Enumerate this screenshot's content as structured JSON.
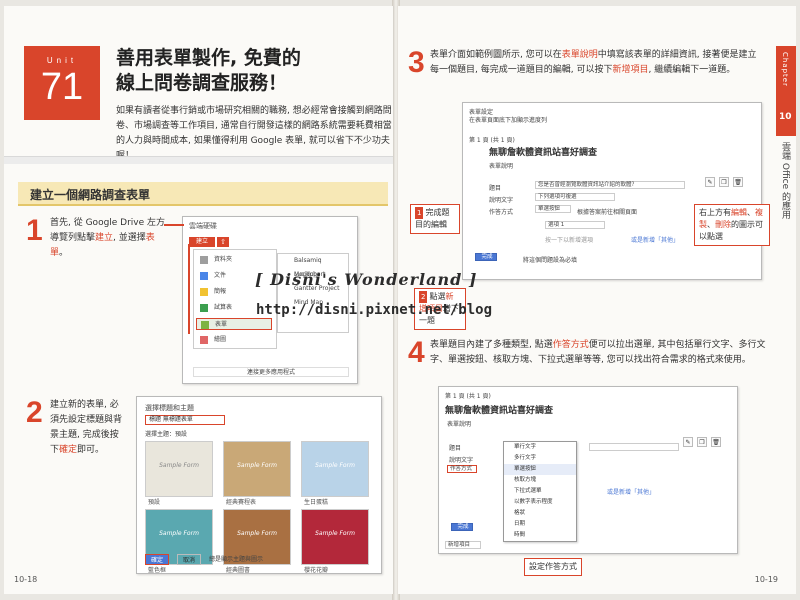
{
  "left_page": {
    "unit_word": "Unit",
    "unit_number": "71",
    "title_line1": "善用表單製作, 免費的",
    "title_line2": "線上問卷調查服務！",
    "intro": "如果有讀者從事行銷或市場研究相關的職務, 想必經常會接觸到網路問卷、市場調查等工作項目, 通常自行開發這樣的網路系統需要耗費相當的人力與時間成本, 如果懂得利用 Google 表單, 就可以省下不少功夫喔！",
    "section_title": "建立一個網路調查表單",
    "step1": {
      "number": "1",
      "text_a": "首先, 從 Google Drive 左方導覽列點擊",
      "text_b": "建立",
      "text_c": ", 並選擇",
      "text_d": "表單",
      "text_e": "。",
      "shot": {
        "header": "雲端硬碟",
        "create_btn": "建立",
        "upload_btn": "⇧",
        "menu_items": [
          "資料夾",
          "文件",
          "簡報",
          "試算表",
          "表單",
          "繪圖"
        ],
        "sub_items": [
          "Balsamiq Mockups",
          "Lucidchart",
          "Gantter Project",
          "Mind Map"
        ],
        "footer": "連接更多應用程式"
      }
    },
    "step2": {
      "number": "2",
      "text_a": "建立新的表單, 必須先設定標題與背景主題, 完成後按下",
      "text_b": "確定",
      "text_c": "即可。",
      "shot": {
        "dialog_title": "選擇標題和主題",
        "title_value": "標題  無標題表單",
        "theme_label": "選擇主題：預設",
        "themes": [
          "預設",
          "經典賽程表",
          "生日蛋糕",
          "藍色框",
          "經典圖書",
          "櫻花花瓣"
        ],
        "theme_sample": "Sample Form",
        "ok": "確定",
        "cancel": "取消",
        "check": "總是顯示主題與圖示"
      }
    },
    "page_number": "10-18"
  },
  "right_page": {
    "step3": {
      "number": "3",
      "text_a": "表單介面如範例圖所示, 您可以在",
      "text_b": "表單說明",
      "text_c": "中填寫該表單的詳細資訊, 接著便是建立每一個題目, 每完成一道題目的編輯, 可以按下",
      "text_d": "新增項目",
      "text_e": ", 繼續編輯下一道題。",
      "shot": {
        "settings_label": "表單設定",
        "settings_check": "在表單頁面底下加顯示進度列",
        "page_label": "第 1 頁 (共 1 頁)",
        "form_title": "無聊詹軟體資訊站喜好調查",
        "form_desc": "表單說明",
        "q_title_label": "題目",
        "q_title_value": "您是否曾經瀏覽軟體資訊站介紹的軟體？",
        "q_help_label": "說明文字",
        "q_help_value": "下列選項可複選",
        "q_type_label": "作答方式",
        "q_type_value": "單選按鈕",
        "q_type_extra": "根據答案前往相關頁面",
        "option1": "選項 1",
        "option_add": "按一下以新增選項",
        "option_other": "或是新增「其他」",
        "done": "完成",
        "required": "將這個問題設為必填",
        "tools": [
          "✎",
          "❐",
          "🗑"
        ]
      },
      "callout_left_badge": "1",
      "callout_left": "完成題目的編輯",
      "callout_right_a": "右上方有",
      "callout_right_b": "編輯",
      "callout_right_c": "、",
      "callout_right_d": "複製",
      "callout_right_e": "、",
      "callout_right_f": "刪除",
      "callout_right_g": "的圖示可以點選",
      "callout_bottom_badge": "2",
      "callout_bottom_a": "點選",
      "callout_bottom_b": "新增項目",
      "callout_bottom_c": "增下一題"
    },
    "watermark_line1": "[ Disni's Wonderland ]",
    "watermark_line2": "http://disni.pixnet.net/blog",
    "step4": {
      "number": "4",
      "text_a": "表單題目內建了多種類型, 點選",
      "text_b": "作答方式",
      "text_c": "便可以拉出選單, 其中包括單行文字、多行文字、單選按鈕、核取方塊、下拉式選單等等, 您可以找出符合需求的格式來使用。",
      "shot": {
        "page_label": "第 1 頁 (共 1 頁)",
        "form_title": "無聊詹軟體資訊站喜好調查",
        "form_desc": "表單說明",
        "q_title_label": "題目",
        "q_help_label": "說明文字",
        "q_type_label": "作答方式",
        "dropdown": [
          "單行文字",
          "多行文字",
          "單選按鈕",
          "核取方塊",
          "下拉式選單",
          "以數字表示程度",
          "格狀",
          "日期",
          "時間"
        ],
        "option_other": "或是新增「其他」",
        "done": "完成",
        "add_item": "新增項目",
        "tools": [
          "✎",
          "❐",
          "🗑"
        ]
      },
      "callout": "設定作答方式"
    },
    "chapter_word": "Chapter",
    "chapter_number": "10",
    "chapter_side": "雲端 Office 的應用",
    "page_number": "10-19"
  },
  "colors": {
    "accent": "#d9452b",
    "band": "#f7e8b6",
    "paper": "#fbfaf7"
  }
}
